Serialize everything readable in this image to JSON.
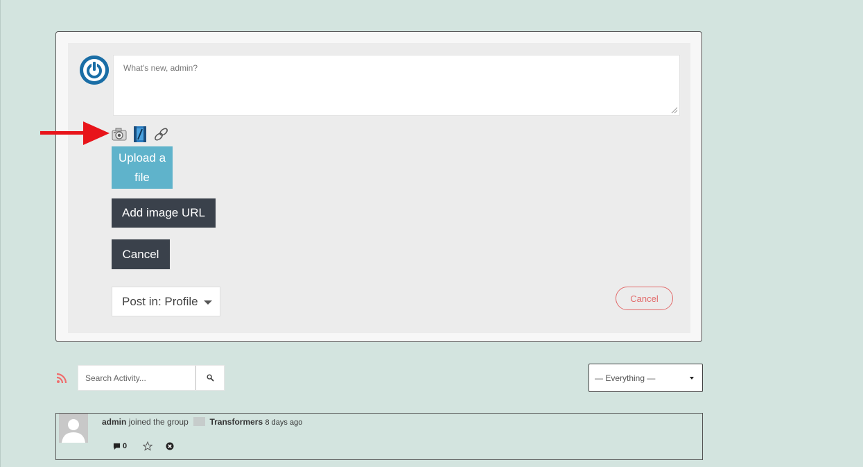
{
  "post_form": {
    "placeholder": "What's new, admin?",
    "media_icons": [
      "camera-icon",
      "film-icon",
      "link-icon"
    ],
    "upload_button": "Upload a file",
    "add_url_button": "Add image URL",
    "cancel_media_button": "Cancel",
    "post_in": "Post in: Profile",
    "cancel_button": "Cancel"
  },
  "filters": {
    "search_placeholder": "Search Activity...",
    "select_value": "— Everything —"
  },
  "activity": [
    {
      "user": "admin",
      "action": "joined the group",
      "group": "Transformers",
      "time": "8 days ago",
      "comments": "0"
    }
  ],
  "colors": {
    "background": "#d3e4df",
    "upload_button": "#5fb3cb",
    "dark_button": "#3a414b",
    "cancel_pill": "#e26b6b",
    "arrow": "#e8141a"
  }
}
